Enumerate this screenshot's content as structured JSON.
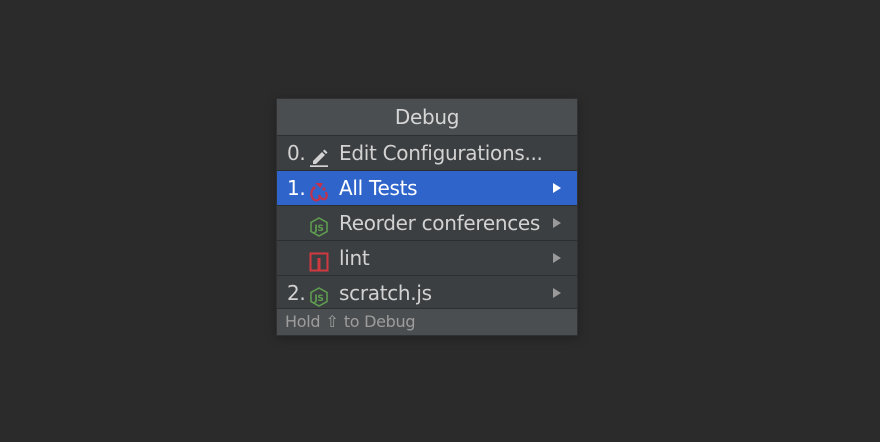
{
  "popup": {
    "title": "Debug",
    "items": [
      {
        "mnemonic": "0.",
        "label": "Edit Configurations...",
        "icon": "pencil-icon",
        "has_submenu": false
      },
      {
        "mnemonic": "1.",
        "label": "All Tests",
        "icon": "jest-icon",
        "has_submenu": true,
        "selected": true
      },
      {
        "mnemonic": "",
        "label": "Reorder conferences",
        "icon": "nodejs-icon",
        "has_submenu": true
      },
      {
        "mnemonic": "",
        "label": "lint",
        "icon": "npm-icon",
        "has_submenu": true
      },
      {
        "mnemonic": "2.",
        "label": "scratch.js",
        "icon": "nodejs-icon",
        "has_submenu": true
      }
    ],
    "footer": {
      "prefix": "Hold",
      "key_symbol": "⇧",
      "suffix": "to Debug"
    }
  },
  "colors": {
    "background": "#2b2b2b",
    "popup": "#3c3f41",
    "selection": "#2f65ca",
    "node_green": "#5f9f50",
    "jest_red": "#c0324c",
    "npm_red": "#d0393f"
  }
}
